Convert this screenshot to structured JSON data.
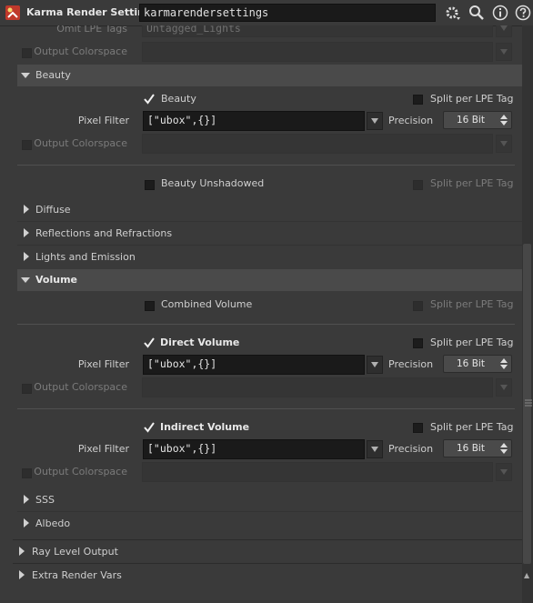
{
  "header": {
    "node_type": "Karma Render Settings",
    "node_name": "karmarendersettings",
    "icons": [
      "karma-node-icon",
      "gear-icon",
      "search-icon",
      "info-icon",
      "help-icon"
    ]
  },
  "rows": {
    "omit_lpe": {
      "label": "Omit LPE Tags",
      "value": "Untagged_Lights"
    },
    "colorspace_top": {
      "label": "Output Colorspace"
    }
  },
  "beauty": {
    "folder": "Beauty",
    "toggle": "Beauty",
    "split": "Split per LPE Tag",
    "pixel_filter_label": "Pixel Filter",
    "pixel_filter": "[\"ubox\",{}]",
    "precision_label": "Precision",
    "precision": "16 Bit",
    "colorspace": "Output Colorspace",
    "unshadowed": "Beauty Unshadowed",
    "unshadowed_split": "Split per LPE Tag"
  },
  "folders": {
    "diffuse": "Diffuse",
    "reflections": "Reflections and Refractions",
    "lights": "Lights and Emission",
    "volume": "Volume",
    "sss": "SSS",
    "albedo": "Albedo",
    "ray_level": "Ray Level Output",
    "extra": "Extra Render Vars"
  },
  "volume": {
    "combined": "Combined Volume",
    "combined_split": "Split per LPE Tag",
    "direct": {
      "toggle": "Direct Volume",
      "split": "Split per LPE Tag",
      "pixel_filter_label": "Pixel Filter",
      "pixel_filter": "[\"ubox\",{}]",
      "precision_label": "Precision",
      "precision": "16 Bit",
      "colorspace": "Output Colorspace"
    },
    "indirect": {
      "toggle": "Indirect Volume",
      "split": "Split per LPE Tag",
      "pixel_filter_label": "Pixel Filter",
      "pixel_filter": "[\"ubox\",{}]",
      "precision_label": "Precision",
      "precision": "16 Bit",
      "colorspace": "Output Colorspace"
    }
  }
}
